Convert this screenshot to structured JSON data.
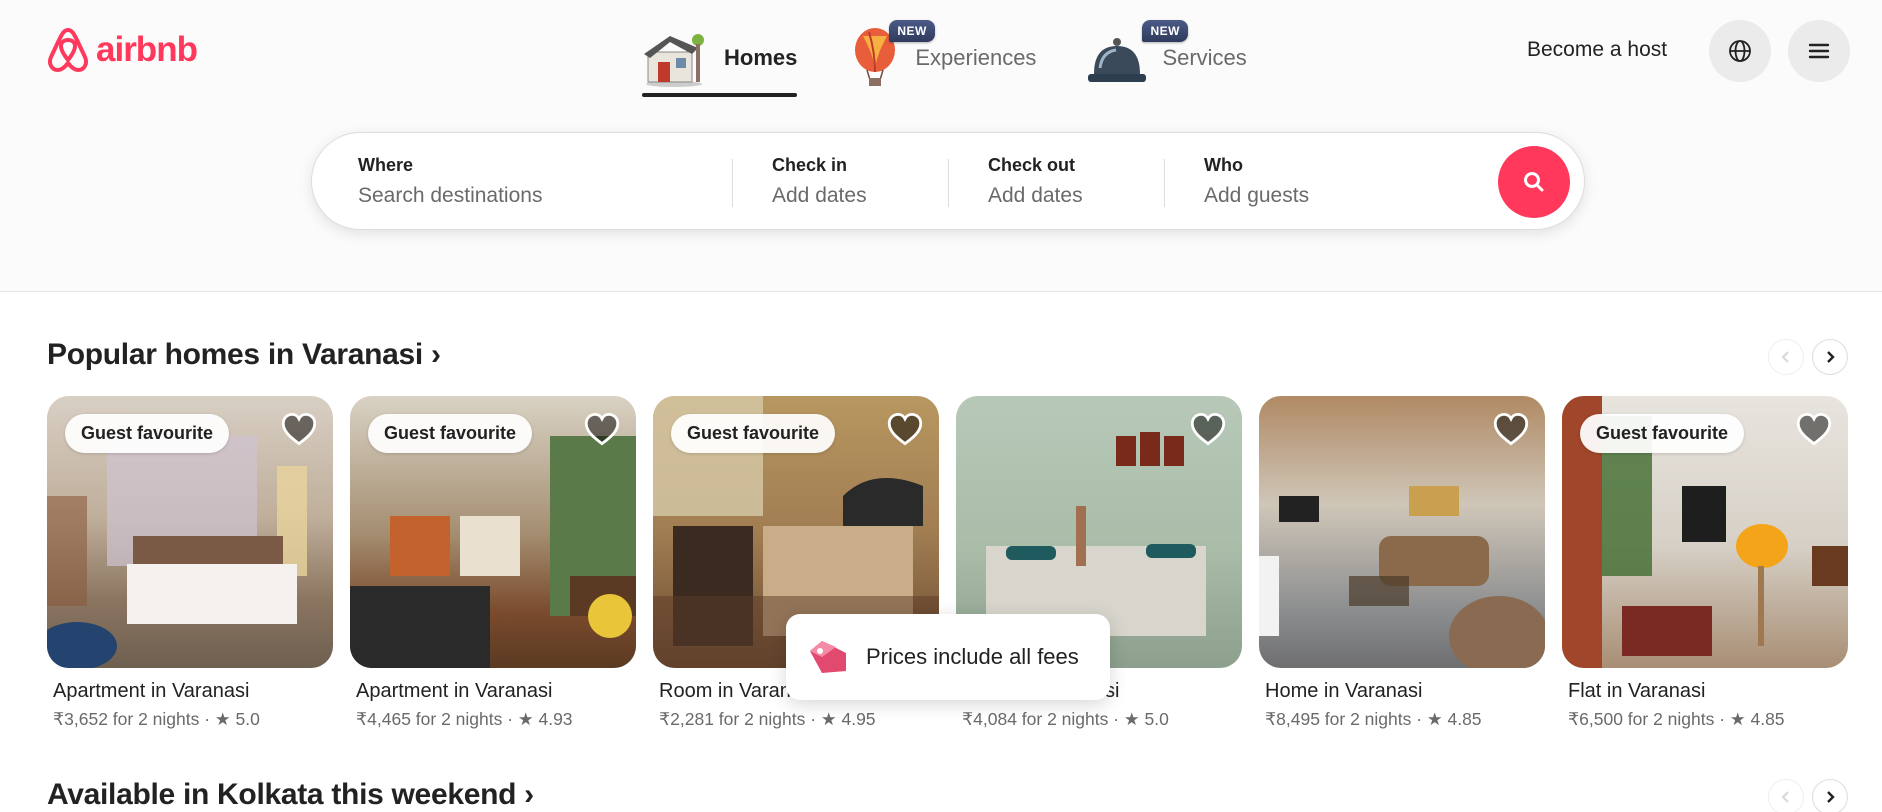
{
  "brand": {
    "name": "airbnb",
    "color": "#ff385c"
  },
  "nav": {
    "tabs": [
      {
        "label": "Homes",
        "icon": "house-icon",
        "active": true,
        "badge": ""
      },
      {
        "label": "Experiences",
        "icon": "hot-air-balloon-icon",
        "active": false,
        "badge": "NEW"
      },
      {
        "label": "Services",
        "icon": "service-bell-icon",
        "active": false,
        "badge": "NEW"
      }
    ],
    "become_host": "Become a host"
  },
  "search": {
    "where_label": "Where",
    "where_placeholder": "Search destinations",
    "checkin_label": "Check in",
    "checkin_value": "Add dates",
    "checkout_label": "Check out",
    "checkout_value": "Add dates",
    "who_label": "Who",
    "who_value": "Add guests"
  },
  "sections": [
    {
      "title": "Popular homes in Varanasi ›"
    },
    {
      "title": "Available in Kolkata this weekend ›"
    }
  ],
  "listings": [
    {
      "badge": "Guest favourite",
      "title": "Apartment in Varanasi",
      "subtitle": "₹3,652 for 2 nights · ★ 5.0"
    },
    {
      "badge": "Guest favourite",
      "title": "Apartment in Varanasi",
      "subtitle": "₹4,465 for 2 nights · ★ 4.93"
    },
    {
      "badge": "Guest favourite",
      "title": "Room in Varanasi",
      "subtitle": "₹2,281 for 2 nights · ★ 4.95"
    },
    {
      "badge": "",
      "title": "Home in Varanasi",
      "subtitle": "₹4,084 for 2 nights · ★ 5.0"
    },
    {
      "badge": "",
      "title": "Home in Varanasi",
      "subtitle": "₹8,495 for 2 nights · ★ 4.85"
    },
    {
      "badge": "Guest favourite",
      "title": "Flat in Varanasi",
      "subtitle": "₹6,500 for 2 nights · ★ 4.85"
    }
  ],
  "toast": {
    "text": "Prices include all fees"
  }
}
